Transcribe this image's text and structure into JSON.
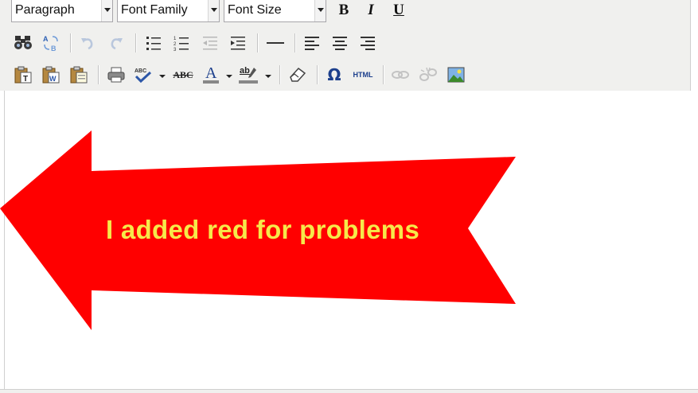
{
  "toolbar": {
    "format_select": "Paragraph",
    "font_family_select": "Font Family",
    "font_size_select": "Font Size",
    "bold_label": "B",
    "italic_label": "I",
    "underline_label": "U",
    "special_char_label": "Ω",
    "html_label": "HTML",
    "strikethrough_label": "ABC",
    "spellcheck_label": "ABC",
    "text_color_label": "A",
    "bg_color_label": "ab"
  },
  "editor": {
    "annotation_text": "I added red for problems"
  },
  "colors": {
    "arrow_fill": "#ff0000",
    "annotation_text": "#f6e94a",
    "toolbar_bg": "#f0f0ee"
  },
  "icons": [
    "find-icon",
    "replace-icon",
    "undo-icon",
    "redo-icon",
    "bullet-list-icon",
    "numbered-list-icon",
    "outdent-icon",
    "indent-icon",
    "horizontal-rule-icon",
    "align-left-icon",
    "align-center-icon",
    "align-right-icon",
    "paste-text-icon",
    "paste-word-icon",
    "paste-icon",
    "print-icon",
    "spellcheck-icon",
    "strikethrough-icon",
    "text-color-icon",
    "background-color-icon",
    "remove-format-icon",
    "special-character-icon",
    "html-source-icon",
    "link-icon",
    "unlink-icon",
    "insert-image-icon"
  ]
}
